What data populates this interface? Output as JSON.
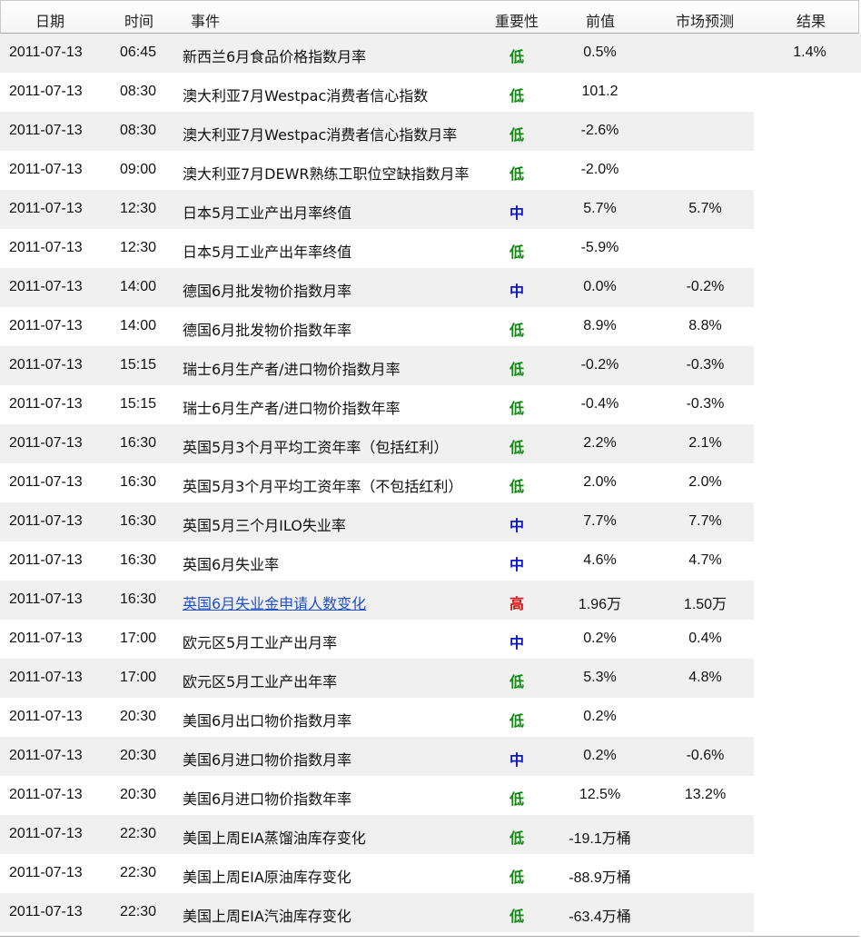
{
  "header": {
    "date": "日期",
    "time": "时间",
    "event": "事件",
    "importance": "重要性",
    "previous": "前值",
    "forecast": "市场预测",
    "result": "结果"
  },
  "rows": [
    {
      "date": "2011-07-13",
      "time": "06:45",
      "event": "新西兰6月食品价格指数月率",
      "importance": "低",
      "level": "low",
      "previous": "0.5%",
      "forecast": "",
      "result": "1.4%"
    },
    {
      "date": "2011-07-13",
      "time": "08:30",
      "event": "澳大利亚7月Westpac消费者信心指数",
      "importance": "低",
      "level": "low",
      "previous": "101.2",
      "forecast": "",
      "result": ""
    },
    {
      "date": "2011-07-13",
      "time": "08:30",
      "event": "澳大利亚7月Westpac消费者信心指数月率",
      "importance": "低",
      "level": "low",
      "previous": "-2.6%",
      "forecast": "",
      "result": ""
    },
    {
      "date": "2011-07-13",
      "time": "09:00",
      "event": "澳大利亚7月DEWR熟练工职位空缺指数月率",
      "importance": "低",
      "level": "low",
      "previous": "-2.0%",
      "forecast": "",
      "result": ""
    },
    {
      "date": "2011-07-13",
      "time": "12:30",
      "event": "日本5月工业产出月率终值",
      "importance": "中",
      "level": "mid",
      "previous": "5.7%",
      "forecast": "5.7%",
      "result": ""
    },
    {
      "date": "2011-07-13",
      "time": "12:30",
      "event": "日本5月工业产出年率终值",
      "importance": "低",
      "level": "low",
      "previous": "-5.9%",
      "forecast": "",
      "result": ""
    },
    {
      "date": "2011-07-13",
      "time": "14:00",
      "event": "德国6月批发物价指数月率",
      "importance": "中",
      "level": "mid",
      "previous": "0.0%",
      "forecast": "-0.2%",
      "result": ""
    },
    {
      "date": "2011-07-13",
      "time": "14:00",
      "event": "德国6月批发物价指数年率",
      "importance": "低",
      "level": "low",
      "previous": "8.9%",
      "forecast": "8.8%",
      "result": ""
    },
    {
      "date": "2011-07-13",
      "time": "15:15",
      "event": "瑞士6月生产者/进口物价指数月率",
      "importance": "低",
      "level": "low",
      "previous": "-0.2%",
      "forecast": "-0.3%",
      "result": ""
    },
    {
      "date": "2011-07-13",
      "time": "15:15",
      "event": "瑞士6月生产者/进口物价指数年率",
      "importance": "低",
      "level": "low",
      "previous": "-0.4%",
      "forecast": "-0.3%",
      "result": ""
    },
    {
      "date": "2011-07-13",
      "time": "16:30",
      "event": "英国5月3个月平均工资年率（包括红利）",
      "importance": "低",
      "level": "low",
      "previous": "2.2%",
      "forecast": "2.1%",
      "result": ""
    },
    {
      "date": "2011-07-13",
      "time": "16:30",
      "event": "英国5月3个月平均工资年率（不包括红利）",
      "importance": "低",
      "level": "low",
      "previous": "2.0%",
      "forecast": "2.0%",
      "result": ""
    },
    {
      "date": "2011-07-13",
      "time": "16:30",
      "event": "英国5月三个月ILO失业率",
      "importance": "中",
      "level": "mid",
      "previous": "7.7%",
      "forecast": "7.7%",
      "result": ""
    },
    {
      "date": "2011-07-13",
      "time": "16:30",
      "event": "英国6月失业率",
      "importance": "中",
      "level": "mid",
      "previous": "4.6%",
      "forecast": "4.7%",
      "result": ""
    },
    {
      "date": "2011-07-13",
      "time": "16:30",
      "event": "英国6月失业金申请人数变化",
      "importance": "高",
      "level": "high",
      "previous": "1.96万",
      "forecast": "1.50万",
      "result": "",
      "link": true
    },
    {
      "date": "2011-07-13",
      "time": "17:00",
      "event": "欧元区5月工业产出月率",
      "importance": "中",
      "level": "mid",
      "previous": "0.2%",
      "forecast": "0.4%",
      "result": ""
    },
    {
      "date": "2011-07-13",
      "time": "17:00",
      "event": "欧元区5月工业产出年率",
      "importance": "低",
      "level": "low",
      "previous": "5.3%",
      "forecast": "4.8%",
      "result": ""
    },
    {
      "date": "2011-07-13",
      "time": "20:30",
      "event": "美国6月出口物价指数月率",
      "importance": "低",
      "level": "low",
      "previous": "0.2%",
      "forecast": "",
      "result": ""
    },
    {
      "date": "2011-07-13",
      "time": "20:30",
      "event": "美国6月进口物价指数月率",
      "importance": "中",
      "level": "mid",
      "previous": "0.2%",
      "forecast": "-0.6%",
      "result": ""
    },
    {
      "date": "2011-07-13",
      "time": "20:30",
      "event": "美国6月进口物价指数年率",
      "importance": "低",
      "level": "low",
      "previous": "12.5%",
      "forecast": "13.2%",
      "result": ""
    },
    {
      "date": "2011-07-13",
      "time": "22:30",
      "event": "美国上周EIA蒸馏油库存变化",
      "importance": "低",
      "level": "low",
      "previous": "-19.1万桶",
      "forecast": "",
      "result": ""
    },
    {
      "date": "2011-07-13",
      "time": "22:30",
      "event": "美国上周EIA原油库存变化",
      "importance": "低",
      "level": "low",
      "previous": "-88.9万桶",
      "forecast": "",
      "result": ""
    },
    {
      "date": "2011-07-13",
      "time": "22:30",
      "event": "美国上周EIA汽油库存变化",
      "importance": "低",
      "level": "low",
      "previous": "-63.4万桶",
      "forecast": "",
      "result": ""
    }
  ],
  "colors": {
    "low": "#108a10",
    "mid": "#0a14c8",
    "high": "#d21414",
    "link": "#1f4ec9",
    "stripe": "#f0f0f0"
  }
}
